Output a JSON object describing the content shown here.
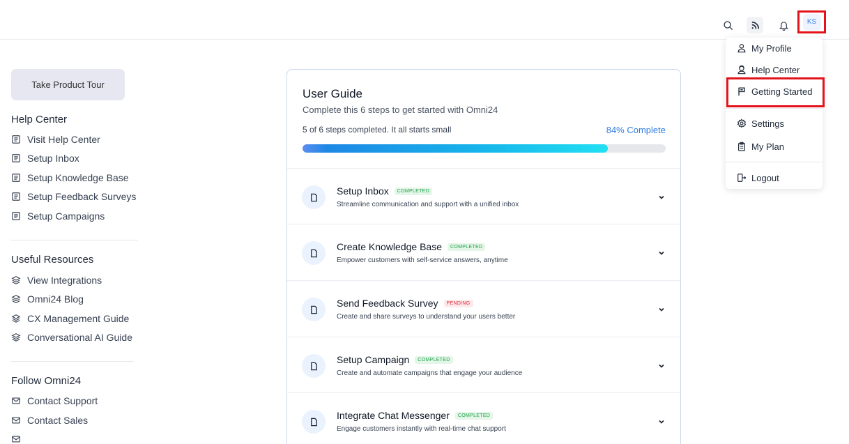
{
  "header": {
    "avatar_initials": "KS"
  },
  "profile_menu": {
    "items": [
      {
        "label": "My Profile",
        "icon": "user-icon"
      },
      {
        "label": "Help Center",
        "icon": "support-agent-icon"
      },
      {
        "label": "Getting Started",
        "icon": "flag-icon"
      },
      {
        "label": "Settings",
        "icon": "gear-icon"
      },
      {
        "label": "My Plan",
        "icon": "clipboard-icon"
      },
      {
        "label": "Logout",
        "icon": "logout-icon"
      }
    ]
  },
  "sidebar": {
    "tour_button": "Take Product Tour",
    "help_center": {
      "heading": "Help Center",
      "links": [
        "Visit Help Center",
        "Setup Inbox",
        "Setup Knowledge Base",
        "Setup Feedback Surveys",
        "Setup Campaigns"
      ]
    },
    "useful_resources": {
      "heading": "Useful Resources",
      "links": [
        "View Integrations",
        "Omni24 Blog",
        "CX Management Guide",
        "Conversational AI Guide"
      ]
    },
    "follow": {
      "heading": "Follow Omni24",
      "links": [
        "Contact Support",
        "Contact Sales"
      ]
    }
  },
  "guide": {
    "title": "User Guide",
    "subtitle": "Complete this 6 steps to get started with Omni24",
    "steps_text": "5 of 6 steps completed. It all starts small",
    "percent_text": "84% Complete",
    "progress": 0.84,
    "steps": [
      {
        "title": "Setup Inbox",
        "status": "COMPLETED",
        "description": "Streamline communication and support with a unified inbox"
      },
      {
        "title": "Create Knowledge Base",
        "status": "COMPLETED",
        "description": "Empower customers with self-service answers, anytime"
      },
      {
        "title": "Send Feedback Survey",
        "status": "PENDING",
        "description": "Create and share surveys to understand your users better"
      },
      {
        "title": "Setup Campaign",
        "status": "COMPLETED",
        "description": "Create and automate campaigns that engage your audience"
      },
      {
        "title": "Integrate Chat Messenger",
        "status": "COMPLETED",
        "description": "Engage customers instantly with real-time chat support"
      }
    ]
  },
  "colors": {
    "accent": "#2f7de1",
    "highlight": "#e3131b",
    "completed": "#22a04b",
    "pending": "#e0303e"
  }
}
